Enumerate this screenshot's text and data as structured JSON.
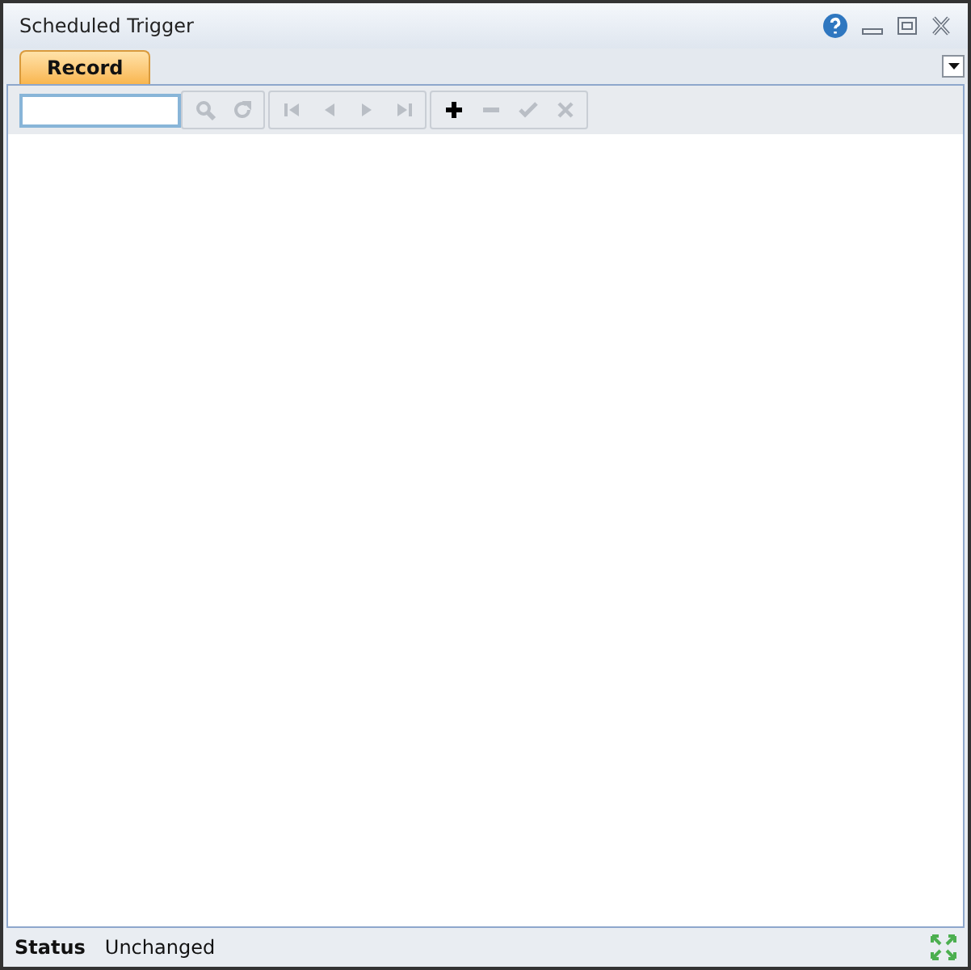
{
  "window": {
    "title": "Scheduled Trigger"
  },
  "tabs": [
    {
      "label": "Record",
      "selected": true
    }
  ],
  "toolbar_groups": [
    [
      {
        "kind": "search",
        "disabled": true
      },
      {
        "kind": "refresh",
        "disabled": true
      }
    ],
    [
      {
        "kind": "first",
        "disabled": true
      },
      {
        "kind": "prev",
        "disabled": true
      },
      {
        "kind": "next",
        "disabled": true
      },
      {
        "kind": "last",
        "disabled": true
      }
    ],
    [
      {
        "kind": "add",
        "disabled": false
      },
      {
        "kind": "remove",
        "disabled": true
      },
      {
        "kind": "accept",
        "disabled": true
      },
      {
        "kind": "cancel",
        "disabled": true
      }
    ]
  ],
  "status_bar": {
    "label": "Status",
    "value": "Unchanged"
  }
}
